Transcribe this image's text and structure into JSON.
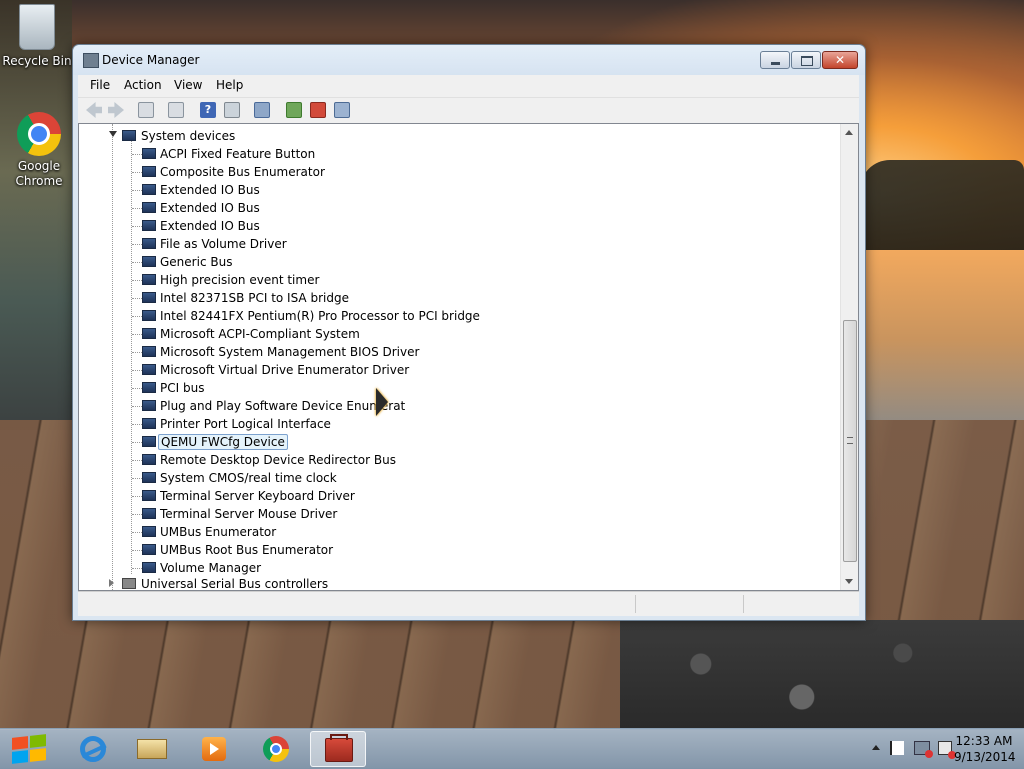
{
  "desktop": {
    "icons": [
      {
        "label": "Recycle Bin"
      },
      {
        "label": "Google Chrome"
      }
    ]
  },
  "window": {
    "title": "Device Manager",
    "close_glyph": "✕",
    "menu": [
      "File",
      "Action",
      "View",
      "Help"
    ],
    "toolbar_help_glyph": "?"
  },
  "tree": {
    "group": "System devices",
    "devices": [
      "ACPI Fixed Feature Button",
      "Composite Bus Enumerator",
      "Extended IO Bus",
      "Extended IO Bus",
      "Extended IO Bus",
      "File as Volume Driver",
      "Generic Bus",
      "High precision event timer",
      "Intel 82371SB PCI to ISA bridge",
      "Intel 82441FX Pentium(R) Pro Processor to PCI bridge",
      "Microsoft ACPI-Compliant System",
      "Microsoft System Management BIOS Driver",
      "Microsoft Virtual Drive Enumerator Driver",
      "PCI bus",
      "Plug and Play Software Device Enumerat",
      "Printer Port Logical Interface",
      "QEMU FWCfg Device",
      "Remote Desktop Device Redirector Bus",
      "System CMOS/real time clock",
      "Terminal Server Keyboard Driver",
      "Terminal Server Mouse Driver",
      "UMBus Enumerator",
      "UMBus Root Bus Enumerator",
      "Volume Manager"
    ],
    "selected_index": 16,
    "next_group": "Universal Serial Bus controllers"
  },
  "taskbar": {
    "time": "12:33 AM",
    "date": "9/13/2014"
  },
  "colors": {
    "selection_bg": "#e5f3fb",
    "selection_border": "#7da2ce",
    "close_button": "#c3452c"
  }
}
